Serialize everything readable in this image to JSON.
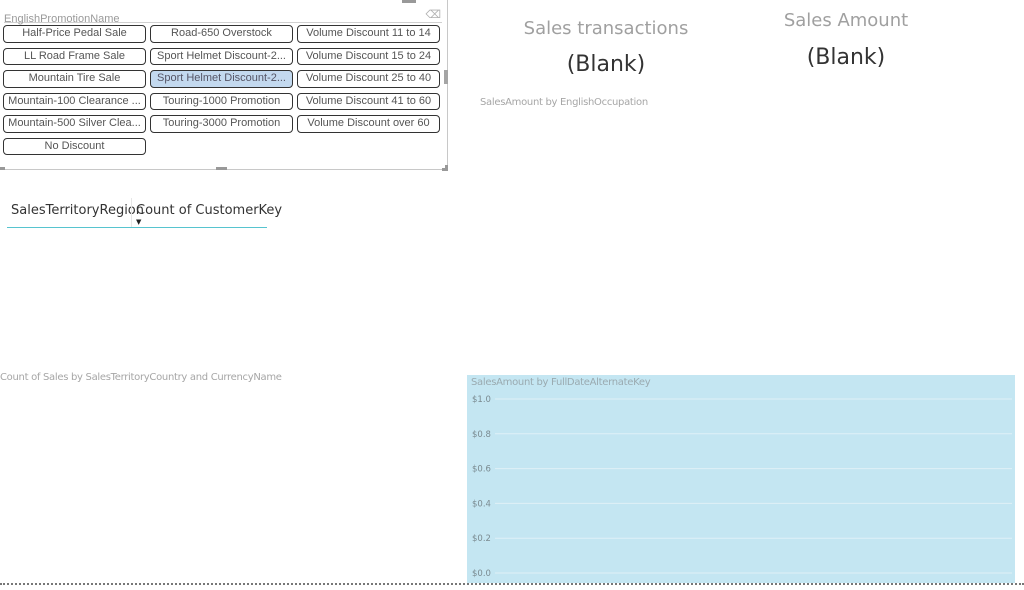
{
  "slicer": {
    "title": "EnglishPromotionName",
    "eraser_icon": "eraser-icon",
    "items": [
      {
        "label": "Half-Price Pedal Sale",
        "selected": false
      },
      {
        "label": "Road-650 Overstock",
        "selected": false
      },
      {
        "label": "Volume Discount 11 to 14",
        "selected": false
      },
      {
        "label": "LL Road Frame Sale",
        "selected": false
      },
      {
        "label": "Sport Helmet Discount-2...",
        "selected": false
      },
      {
        "label": "Volume Discount 15 to 24",
        "selected": false
      },
      {
        "label": "Mountain Tire Sale",
        "selected": false
      },
      {
        "label": "Sport Helmet Discount-2...",
        "selected": true
      },
      {
        "label": "Volume Discount 25 to 40",
        "selected": false
      },
      {
        "label": "Mountain-100 Clearance ...",
        "selected": false
      },
      {
        "label": "Touring-1000 Promotion",
        "selected": false
      },
      {
        "label": "Volume Discount 41 to 60",
        "selected": false
      },
      {
        "label": "Mountain-500 Silver Clea...",
        "selected": false
      },
      {
        "label": "Touring-3000 Promotion",
        "selected": false
      },
      {
        "label": "Volume Discount over 60",
        "selected": false
      },
      {
        "label": "No Discount",
        "selected": false
      }
    ]
  },
  "cards": [
    {
      "label": "Sales transactions",
      "value": "(Blank)"
    },
    {
      "label": "Sales Amount",
      "value": "(Blank)"
    }
  ],
  "visual_titles": {
    "occupation": "SalesAmount by EnglishOccupation",
    "country": "Count of Sales by SalesTerritoryCountry and CurrencyName"
  },
  "table": {
    "columns": [
      "SalesTerritoryRegion",
      "Count of CustomerKey"
    ],
    "sort_icon": "sort-descending-icon",
    "rows": []
  },
  "chart_data": {
    "type": "line",
    "title": "SalesAmount by FullDateAlternateKey",
    "xlabel": "",
    "ylabel": "",
    "ylim": [
      0,
      1.0
    ],
    "yticks": [
      "$0.0",
      "$0.2",
      "$0.4",
      "$0.6",
      "$0.8",
      "$1.0"
    ],
    "ytick_values": [
      0,
      0.2,
      0.4,
      0.6,
      0.8,
      1.0
    ],
    "grid": true,
    "background": "#c4e6f2",
    "series": []
  }
}
